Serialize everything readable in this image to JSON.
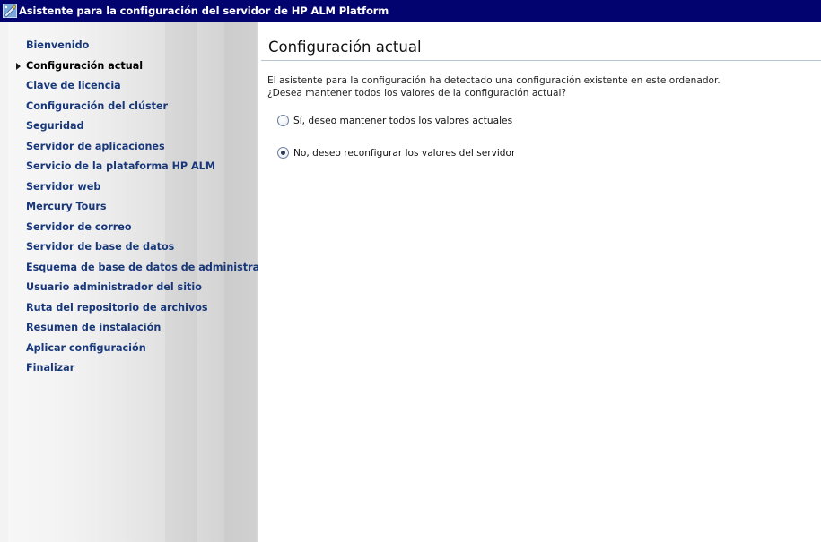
{
  "window": {
    "title": "Asistente para la configuración del servidor de HP ALM Platform"
  },
  "sidebar": {
    "items": [
      {
        "label": "Bienvenido",
        "active": false
      },
      {
        "label": "Configuración actual",
        "active": true
      },
      {
        "label": "Clave de licencia",
        "active": false
      },
      {
        "label": "Configuración del clúster",
        "active": false
      },
      {
        "label": "Seguridad",
        "active": false
      },
      {
        "label": "Servidor de aplicaciones",
        "active": false
      },
      {
        "label": "Servicio de la plataforma HP ALM",
        "active": false
      },
      {
        "label": "Servidor web",
        "active": false
      },
      {
        "label": "Mercury Tours",
        "active": false
      },
      {
        "label": "Servidor de correo",
        "active": false
      },
      {
        "label": "Servidor de base de datos",
        "active": false
      },
      {
        "label": "Esquema de base de datos de administra",
        "active": false
      },
      {
        "label": "Usuario administrador del sitio",
        "active": false
      },
      {
        "label": "Ruta del repositorio de archivos",
        "active": false
      },
      {
        "label": "Resumen de instalación",
        "active": false
      },
      {
        "label": "Aplicar configuración",
        "active": false
      },
      {
        "label": "Finalizar",
        "active": false
      }
    ]
  },
  "main": {
    "title": "Configuración actual",
    "intro_line1": "El asistente para la configuración ha detectado una configuración existente en este ordenador.",
    "intro_line2": "¿Desea mantener todos los valores de la configuración actual?",
    "options": [
      {
        "label": "Sí, deseo mantener todos los valores actuales",
        "selected": false
      },
      {
        "label": "No, deseo reconfigurar los valores del servidor",
        "selected": true
      }
    ]
  },
  "colors": {
    "titlebar": "#03036f",
    "nav_link": "#18387a",
    "title_rule": "#b7c4d2"
  },
  "icons": {
    "titlebar": "wizard-icon",
    "active_marker": "triangle-right-icon"
  }
}
